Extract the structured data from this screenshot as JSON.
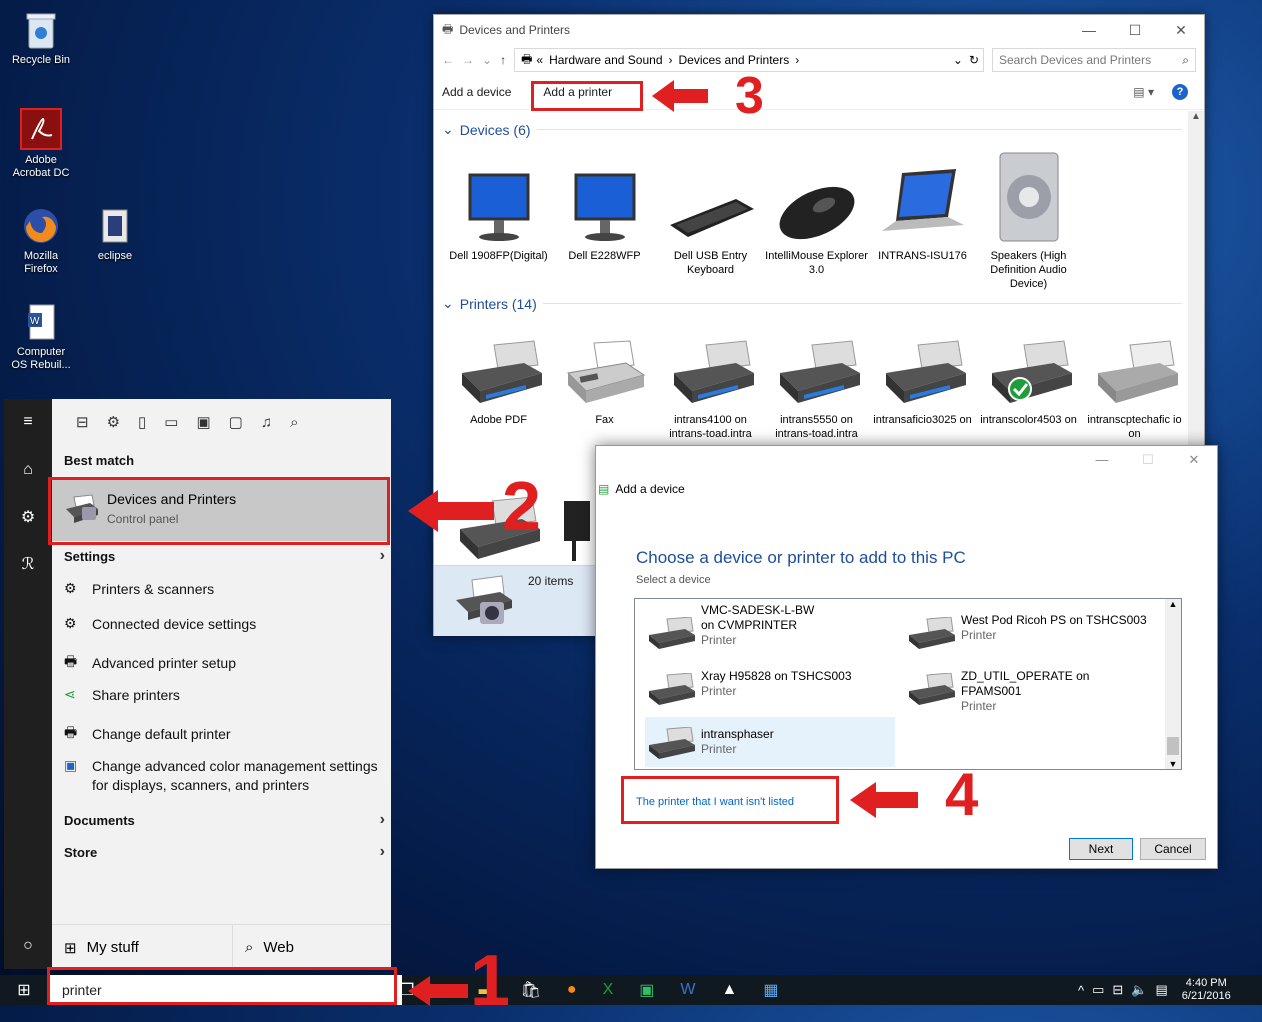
{
  "desktop": {
    "icons": [
      {
        "label": "Recycle Bin"
      },
      {
        "label": "Adobe Acrobat DC"
      },
      {
        "label": "Mozilla Firefox"
      },
      {
        "label": "eclipse"
      },
      {
        "label": "Computer OS Rebuil..."
      }
    ]
  },
  "explorer": {
    "title": "Devices and Printers",
    "breadcrumb": [
      "Hardware and Sound",
      "Devices and Printers"
    ],
    "search_placeholder": "Search Devices and Printers",
    "commands": [
      "Add a device",
      "Add a printer"
    ],
    "devices_group": "Devices (6)",
    "devices": [
      {
        "name": "Dell 1908FP(Digital)"
      },
      {
        "name": "Dell E228WFP"
      },
      {
        "name": "Dell USB Entry Keyboard"
      },
      {
        "name": "IntelliMouse Explorer 3.0"
      },
      {
        "name": "INTRANS-ISU176"
      },
      {
        "name": "Speakers (High Definition Audio Device)"
      }
    ],
    "printers_group": "Printers (14)",
    "printers": [
      {
        "name": "Adobe PDF"
      },
      {
        "name": "Fax"
      },
      {
        "name": "intrans4100 on intrans-toad.intra"
      },
      {
        "name": "intrans5550 on intrans-toad.intra"
      },
      {
        "name": "intransaficio3025 on"
      },
      {
        "name": "intranscolor4503 on"
      },
      {
        "name": "intranscptechafic io on"
      }
    ],
    "status_items": "20 items"
  },
  "start_menu": {
    "best_match_label": "Best match",
    "best_match": {
      "title": "Devices and Printers",
      "subtitle": "Control panel"
    },
    "settings_label": "Settings",
    "settings": [
      "Printers & scanners",
      "Connected device settings",
      "Advanced printer setup",
      "Share printers",
      "Change default printer",
      "Change advanced color management settings for displays, scanners, and printers"
    ],
    "documents_label": "Documents",
    "store_label": "Store",
    "my_stuff": "My stuff",
    "web": "Web",
    "search_value": "printer"
  },
  "dialog": {
    "header": "Add a device",
    "heading": "Choose a device or printer to add to this PC",
    "subheading": "Select a device",
    "printers": [
      {
        "name": "VMC-SADESK-L-BW on CVMPRINTER",
        "type": "Printer"
      },
      {
        "name": "West Pod Ricoh PS on TSHCS003",
        "type": "Printer"
      },
      {
        "name": "Xray H95828 on TSHCS003",
        "type": "Printer"
      },
      {
        "name": "ZD_UTIL_OPERATE on FPAMS001",
        "type": "Printer"
      },
      {
        "name": "intransphaser",
        "type": "Printer"
      }
    ],
    "not_listed_link": "The printer that I want isn't listed",
    "next": "Next",
    "cancel": "Cancel"
  },
  "taskbar": {
    "time": "4:40 PM",
    "date": "6/21/2016"
  },
  "annotations": [
    "1",
    "2",
    "3",
    "4"
  ],
  "colors": {
    "annotation_red": "#e02020",
    "link_blue": "#0066cc",
    "heading_blue": "#1e4e9a"
  }
}
